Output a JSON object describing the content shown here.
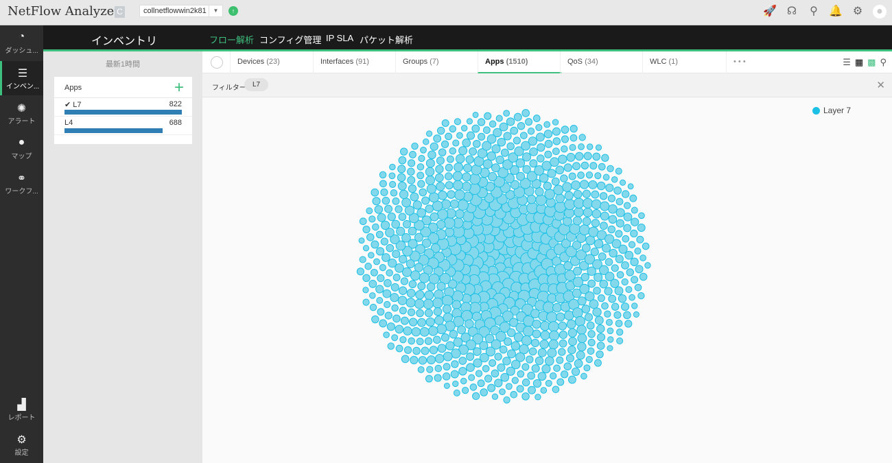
{
  "header": {
    "title": "NetFlow Analyzer",
    "badge": "C",
    "collector": "collnetflowwin2k81"
  },
  "sidebar": [
    {
      "label": "ダッシュ...",
      "icon": "dashboard-icon"
    },
    {
      "label": "インベン...",
      "icon": "inventory-icon"
    },
    {
      "label": "アラート",
      "icon": "alarm-icon"
    },
    {
      "label": "マップ",
      "icon": "map-pin-icon"
    },
    {
      "label": "ワークフ...",
      "icon": "workflow-icon"
    },
    {
      "label": "レポート",
      "icon": "report-icon"
    },
    {
      "label": "設定",
      "icon": "settings-icon"
    }
  ],
  "nav": {
    "title": "インベントリ",
    "items": [
      "フロー解析",
      "コンフィグ管理",
      "IP SLA",
      "パケット解析"
    ]
  },
  "left": {
    "period": "最新1時間",
    "card_title": "Apps",
    "items": [
      {
        "label": "L7",
        "count": 822,
        "checked": true
      },
      {
        "label": "L4",
        "count": 688
      }
    ]
  },
  "tabs": [
    {
      "label": "Devices",
      "count": "(23)"
    },
    {
      "label": "Interfaces",
      "count": "(91)"
    },
    {
      "label": "Groups",
      "count": "(7)"
    },
    {
      "label": "Apps",
      "count": "(1510)"
    },
    {
      "label": "QoS",
      "count": "(34)"
    },
    {
      "label": "WLC",
      "count": "(1)"
    }
  ],
  "more": "• • •",
  "filter": {
    "label": "フィルター",
    "chip": "L7"
  },
  "legend": {
    "label": "Layer 7",
    "color": "#1cc0e6"
  }
}
